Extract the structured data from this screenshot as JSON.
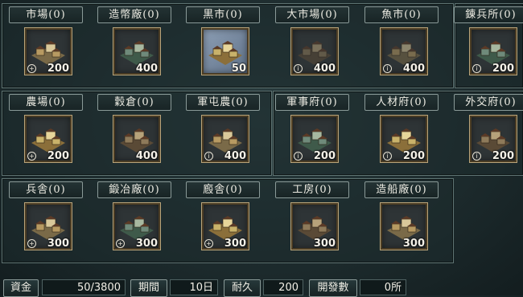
{
  "rows": [
    [
      {
        "name": "市場",
        "count": "(0)",
        "cost": "200",
        "badge": "+",
        "state": "available",
        "icon": "market-icon"
      },
      {
        "name": "造幣廠",
        "count": "(0)",
        "cost": "400",
        "badge": "",
        "state": "available",
        "icon": "mint-icon"
      },
      {
        "name": "黒市",
        "count": "(0)",
        "cost": "50",
        "badge": "",
        "state": "selected",
        "icon": "black-market-icon"
      },
      {
        "name": "大市場",
        "count": "(0)",
        "cost": "400",
        "badge": "i",
        "state": "locked",
        "icon": "grand-market-icon"
      },
      {
        "name": "魚市",
        "count": "(0)",
        "cost": "400",
        "badge": "i",
        "state": "locked",
        "icon": "fish-market-icon"
      },
      {
        "name": "錬兵所",
        "count": "(0)",
        "cost": "200",
        "badge": "i",
        "state": "available",
        "icon": "training-ground-icon"
      }
    ],
    [
      {
        "name": "農場",
        "count": "(0)",
        "cost": "200",
        "badge": "+",
        "state": "available",
        "icon": "farm-icon"
      },
      {
        "name": "穀倉",
        "count": "(0)",
        "cost": "400",
        "badge": "",
        "state": "available",
        "icon": "granary-icon"
      },
      {
        "name": "軍屯農",
        "count": "(0)",
        "cost": "400",
        "badge": "i",
        "state": "available",
        "icon": "military-farm-icon"
      },
      {
        "name": "軍事府",
        "count": "(0)",
        "cost": "200",
        "badge": "i",
        "state": "available",
        "icon": "military-office-icon"
      },
      {
        "name": "人材府",
        "count": "(0)",
        "cost": "200",
        "badge": "i",
        "state": "available",
        "icon": "talent-office-icon"
      },
      {
        "name": "外交府",
        "count": "(0)",
        "cost": "200",
        "badge": "i",
        "state": "available",
        "icon": "diplomacy-office-icon"
      }
    ],
    [
      {
        "name": "兵舎",
        "count": "(0)",
        "cost": "300",
        "badge": "+",
        "state": "available",
        "icon": "barracks-icon"
      },
      {
        "name": "鍛冶廠",
        "count": "(0)",
        "cost": "300",
        "badge": "+",
        "state": "available",
        "icon": "smithy-icon"
      },
      {
        "name": "廏舎",
        "count": "(0)",
        "cost": "300",
        "badge": "+",
        "state": "available",
        "icon": "stable-icon"
      },
      {
        "name": "工房",
        "count": "(0)",
        "cost": "300",
        "badge": "",
        "state": "available",
        "icon": "workshop-icon"
      },
      {
        "name": "造船廠",
        "count": "(0)",
        "cost": "300",
        "badge": "",
        "state": "available",
        "icon": "shipyard-icon"
      }
    ]
  ],
  "status": {
    "funds_label": "資金",
    "funds_value": "50/3800",
    "period_label": "期間",
    "period_value": "10日",
    "durability_label": "耐久",
    "durability_value": "200",
    "developments_label": "開發數",
    "developments_value": "0所"
  },
  "colors": {
    "tile_border": "#b9a47a",
    "panel_border": "#5f7473",
    "background": "#1b2a2c"
  }
}
